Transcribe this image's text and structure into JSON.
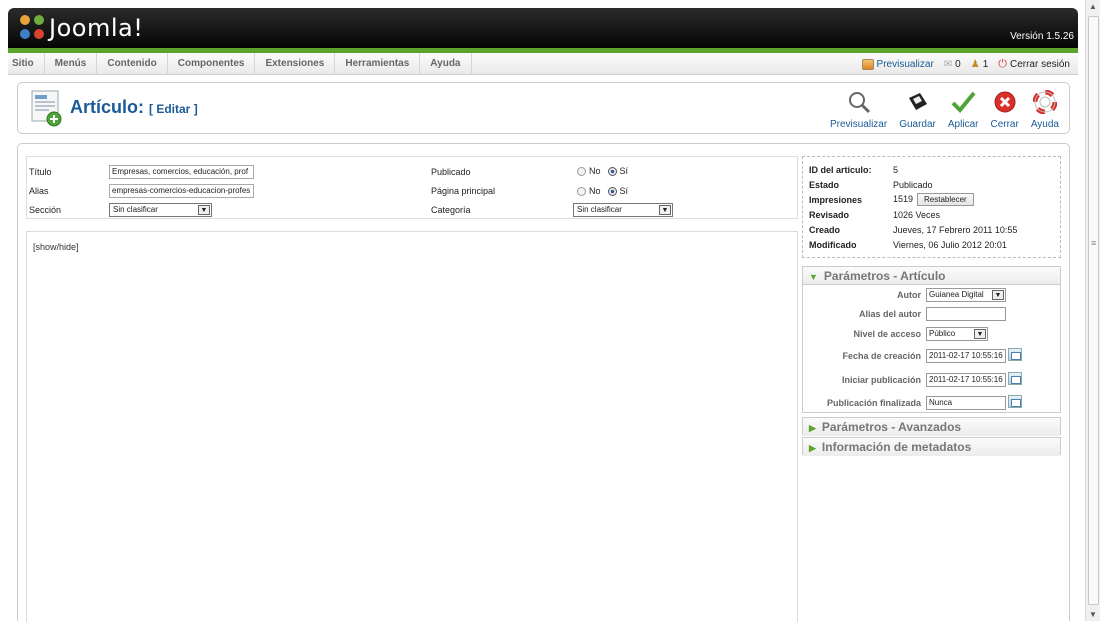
{
  "header": {
    "logo_text": "Joomla!",
    "version": "Versión 1.5.26",
    "accent_color": "#5ca42c"
  },
  "menu": {
    "items": [
      "Sitio",
      "Menús",
      "Contenido",
      "Componentes",
      "Extensiones",
      "Herramientas",
      "Ayuda"
    ]
  },
  "status": {
    "preview": "Previsualizar",
    "messages_count": "0",
    "users_count": "1",
    "logout": "Cerrar sesión"
  },
  "toolbar": {
    "title": "Artículo:",
    "subtitle": "[ Editar ]",
    "buttons": {
      "preview": "Previsualizar",
      "save": "Guardar",
      "apply": "Aplicar",
      "close": "Cerrar",
      "help": "Ayuda"
    }
  },
  "details": {
    "title_label": "Título",
    "title_value": "Empresas, comercios, educación, prof",
    "alias_label": "Alias",
    "alias_value": "empresas-comercios-educacion-profes",
    "section_label": "Sección",
    "section_value": "Sin clasificar",
    "published_label": "Publicado",
    "frontpage_label": "Página principal",
    "category_label": "Categoría",
    "category_value": "Sin clasificar",
    "no": "No",
    "yes": "Sí"
  },
  "editor": {
    "toggle": "[show/hide]"
  },
  "info": {
    "id_label": "ID del artículo:",
    "id_value": "5",
    "state_label": "Estado",
    "state_value": "Publicado",
    "hits_label": "Impresiones",
    "hits_value": "1519",
    "reset_button": "Restablecer",
    "revised_label": "Revisado",
    "revised_value": "1026 Veces",
    "created_label": "Creado",
    "created_value": "Jueves, 17 Febrero 2011 10:55",
    "modified_label": "Modificado",
    "modified_value": "Viernes, 06 Julio 2012 20:01"
  },
  "params_article": {
    "heading": "Parámetros - Artículo",
    "author_label": "Autor",
    "author_value": "Guianea Digital",
    "alias_label": "Alias del autor",
    "alias_value": "",
    "access_label": "Nivel de acceso",
    "access_value": "Público",
    "created_label": "Fecha de creación",
    "created_value": "2011-02-17 10:55:16",
    "start_label": "Iniciar publicación",
    "start_value": "2011-02-17 10:55:16",
    "finish_label": "Publicación finalizada",
    "finish_value": "Nunca"
  },
  "params_advanced": {
    "heading": "Parámetros - Avanzados"
  },
  "metadata": {
    "heading": "Información de metadatos"
  }
}
